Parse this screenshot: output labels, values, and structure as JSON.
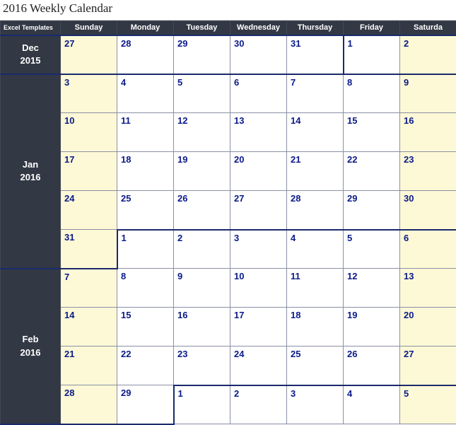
{
  "title": "2016 Weekly Calendar",
  "corner_label": "Excel Templates",
  "day_headers": [
    "Sunday",
    "Monday",
    "Tuesday",
    "Wednesday",
    "Thursday",
    "Friday",
    "Saturda"
  ],
  "months": [
    {
      "label_line1": "Dec",
      "label_line2": "2015",
      "rowspan": 1
    },
    {
      "label_line1": "Jan",
      "label_line2": "2016",
      "rowspan": 5
    },
    {
      "label_line1": "Feb",
      "label_line2": "2016",
      "rowspan": 4
    }
  ],
  "rows": [
    {
      "month_start": 0,
      "cells": [
        {
          "n": "27",
          "w": true,
          "t": true,
          "b": true
        },
        {
          "n": "28",
          "t": true,
          "b": true
        },
        {
          "n": "29",
          "t": true,
          "b": true
        },
        {
          "n": "30",
          "t": true,
          "b": true
        },
        {
          "n": "31",
          "t": true,
          "b": true,
          "r": true
        },
        {
          "n": "1",
          "t": true
        },
        {
          "n": "2",
          "w": true,
          "t": true
        }
      ]
    },
    {
      "month_start": 1,
      "cells": [
        {
          "n": "3",
          "w": true,
          "t": true
        },
        {
          "n": "4",
          "t": true
        },
        {
          "n": "5",
          "t": true
        },
        {
          "n": "6",
          "t": true
        },
        {
          "n": "7",
          "t": true
        },
        {
          "n": "8",
          "t": true
        },
        {
          "n": "9",
          "w": true,
          "t": true
        }
      ]
    },
    {
      "cells": [
        {
          "n": "10",
          "w": true
        },
        {
          "n": "11"
        },
        {
          "n": "12"
        },
        {
          "n": "13"
        },
        {
          "n": "14"
        },
        {
          "n": "15"
        },
        {
          "n": "16",
          "w": true
        }
      ]
    },
    {
      "cells": [
        {
          "n": "17",
          "w": true
        },
        {
          "n": "18"
        },
        {
          "n": "19"
        },
        {
          "n": "20"
        },
        {
          "n": "21"
        },
        {
          "n": "22"
        },
        {
          "n": "23",
          "w": true
        }
      ]
    },
    {
      "cells": [
        {
          "n": "24",
          "w": true
        },
        {
          "n": "25"
        },
        {
          "n": "26"
        },
        {
          "n": "27"
        },
        {
          "n": "28"
        },
        {
          "n": "29"
        },
        {
          "n": "30",
          "w": true
        }
      ]
    },
    {
      "cells": [
        {
          "n": "31",
          "w": true,
          "b": true,
          "r": true
        },
        {
          "n": "1",
          "t": true,
          "l": true
        },
        {
          "n": "2",
          "t": true
        },
        {
          "n": "3",
          "t": true
        },
        {
          "n": "4",
          "t": true
        },
        {
          "n": "5",
          "t": true
        },
        {
          "n": "6",
          "w": true,
          "t": true
        }
      ]
    },
    {
      "month_start": 2,
      "cells": [
        {
          "n": "7",
          "w": true,
          "t": true
        },
        {
          "n": "8"
        },
        {
          "n": "9"
        },
        {
          "n": "10"
        },
        {
          "n": "11"
        },
        {
          "n": "12"
        },
        {
          "n": "13",
          "w": true
        }
      ]
    },
    {
      "cells": [
        {
          "n": "14",
          "w": true
        },
        {
          "n": "15"
        },
        {
          "n": "16"
        },
        {
          "n": "17"
        },
        {
          "n": "18"
        },
        {
          "n": "19"
        },
        {
          "n": "20",
          "w": true
        }
      ]
    },
    {
      "cells": [
        {
          "n": "21",
          "w": true
        },
        {
          "n": "22"
        },
        {
          "n": "23"
        },
        {
          "n": "24"
        },
        {
          "n": "25"
        },
        {
          "n": "26"
        },
        {
          "n": "27",
          "w": true
        }
      ]
    },
    {
      "cells": [
        {
          "n": "28",
          "w": true,
          "b": true
        },
        {
          "n": "29",
          "b": true,
          "r": true
        },
        {
          "n": "1",
          "t": true,
          "l": true
        },
        {
          "n": "2",
          "t": true
        },
        {
          "n": "3",
          "t": true
        },
        {
          "n": "4",
          "t": true
        },
        {
          "n": "5",
          "w": true,
          "t": true
        }
      ]
    }
  ]
}
